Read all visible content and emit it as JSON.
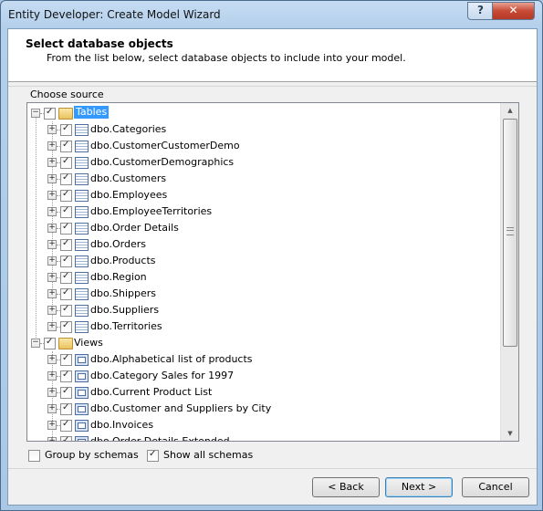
{
  "window": {
    "title": "Entity Developer: Create Model Wizard"
  },
  "titlebar": {
    "help_glyph": "?",
    "close_glyph": "✕"
  },
  "header": {
    "title": "Select database objects",
    "description": "From the list below, select database objects to include into your model."
  },
  "source_label": "Choose source",
  "tree": {
    "tables": {
      "label": "Tables",
      "items": [
        "dbo.Categories",
        "dbo.CustomerCustomerDemo",
        "dbo.CustomerDemographics",
        "dbo.Customers",
        "dbo.Employees",
        "dbo.EmployeeTerritories",
        "dbo.Order Details",
        "dbo.Orders",
        "dbo.Products",
        "dbo.Region",
        "dbo.Shippers",
        "dbo.Suppliers",
        "dbo.Territories"
      ]
    },
    "views": {
      "label": "Views",
      "items": [
        "dbo.Alphabetical list of products",
        "dbo.Category Sales for 1997",
        "dbo.Current Product List",
        "dbo.Customer and Suppliers by City",
        "dbo.Invoices",
        "dbo.Order Details Extended"
      ]
    },
    "glyphs": {
      "collapse": "−",
      "expand": "+",
      "check": "✓"
    }
  },
  "options": {
    "group_by_schemas": {
      "label": "Group by schemas",
      "checked": false
    },
    "show_all_schemas": {
      "label": "Show all schemas",
      "checked": true
    }
  },
  "buttons": {
    "back": "< Back",
    "next": "Next >",
    "cancel": "Cancel"
  }
}
